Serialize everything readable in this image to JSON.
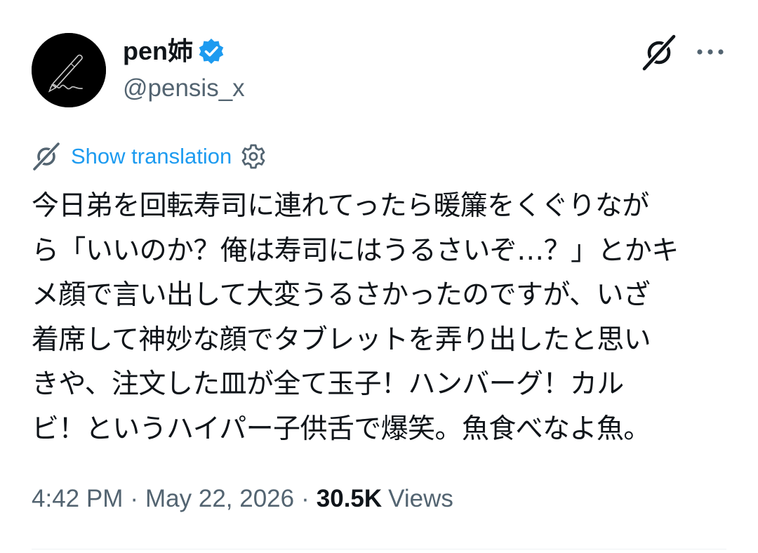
{
  "user": {
    "display_name": "pen姉",
    "handle": "@pensis_x",
    "verified": true,
    "verified_color": "#1d9bf0",
    "avatar_icon": "pen-signature-icon"
  },
  "actions": {
    "grok_icon": "grok-icon",
    "more_icon": "more-dots-icon"
  },
  "translation": {
    "label": "Show translation",
    "icon": "grok-icon",
    "settings_icon": "gear-icon",
    "color": "#1d9bf0"
  },
  "tweet": {
    "lines": [
      "今日弟を回転寿司に連れてったら暖簾をくぐりなが",
      "ら「いいのか？俺は寿司にはうるさいぞ…？」とかキ",
      "メ顔で言い出して大変うるさかったのですが、いざ",
      "着席して神妙な顔でタブレットを弄り出したと思い",
      "きや、注文した皿が全て玉子！ハンバーグ！カル",
      "ビ！というハイパー子供舌で爆笑。魚食べなよ魚。"
    ]
  },
  "meta": {
    "time": "4:42 PM",
    "date": "May 22, 2026",
    "separator": "·",
    "views_count": "30.5K",
    "views_label": "Views"
  }
}
